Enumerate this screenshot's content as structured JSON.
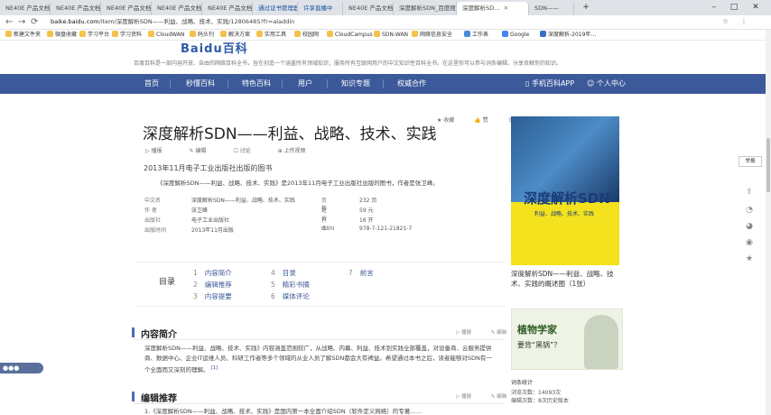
{
  "browser": {
    "tabs": [
      {
        "label": "NE40E 产品文档 V800R0…",
        "active": false
      },
      {
        "label": "NE40E 产品文档 V800R021…",
        "active": false
      },
      {
        "label": "NE40E 产品文档 V800R021…",
        "active": false
      },
      {
        "label": "NE40E 产品文档 V800R021…",
        "active": false
      },
      {
        "label": "NE40E 产品文档 V800R021…",
        "active": false
      },
      {
        "label": "通过证书管理器",
        "active": false
      },
      {
        "label": "许享直播中",
        "active": false
      },
      {
        "label": "NE40E 产品文档…",
        "active": false
      },
      {
        "label": "深度解析SDN_百度搜索",
        "active": false
      },
      {
        "label": "深度解析SD…",
        "active": true
      },
      {
        "label": "SDN——",
        "active": false
      }
    ],
    "url_host": "baike.baidu.com",
    "url_path": "/item/深度解析SDN——利益、战略、技术、实践/12806485?fr=aladdin",
    "bookmarks": [
      "新建文件夹",
      "微盘收藏",
      "学习平台",
      "学习资料",
      "CloudWAN",
      "码头刊",
      "解决方案",
      "实用工具",
      "校园网",
      "CloudCampus",
      "SDN-WAN",
      "网络信息安全",
      "工作表",
      "Google",
      "深度解析-2019年…"
    ]
  },
  "site": {
    "brand": "Baidu百科",
    "notice": "百度百科是一部内容开放、自由的网络百科全书，旨在创造一个涵盖所有领域知识，服务所有互联网用户的中文知识性百科全书。在这里你可以参与词条编辑，分享贡献你的知识。",
    "nav": [
      "首页",
      "秒懂百科",
      "特色百科",
      "用户",
      "知识专题",
      "权威合作"
    ],
    "nav_right": [
      "手机百科APP",
      "个人中心"
    ]
  },
  "article": {
    "title": "深度解析SDN——利益、战略、技术、实践",
    "actions": [
      "播报",
      "编辑",
      "讨论",
      "上传视频"
    ],
    "top_right": [
      "收藏",
      "赞"
    ],
    "subtitle": "2013年11月电子工业出版社出版的图书",
    "summary": "《深度解析SDN——利益、战略、技术、实践》是2013年11月电子工业出版社出版的图书，作者是张卫峰。",
    "info_rows": [
      {
        "k": "中文名",
        "v": "深度解析SDN——利益、战略、技术、实践",
        "k2": "页 数",
        "v2": "232 页"
      },
      {
        "k": "作 者",
        "v": "张卫峰",
        "k2": "定 价",
        "v2": "59 元"
      },
      {
        "k": "出版社",
        "v": "电子工业出版社",
        "k2": "开 本",
        "v2": "16 开"
      },
      {
        "k": "出版时间",
        "v": "2013年11月出版",
        "k2": "ISBN",
        "v2": "978-7-121-21821-7"
      }
    ],
    "toc_label": "目录",
    "toc": [
      {
        "n": "1",
        "t": "内容简介"
      },
      {
        "n": "2",
        "t": "编辑推荐"
      },
      {
        "n": "3",
        "t": "内容提要"
      },
      {
        "n": "4",
        "t": "目录"
      },
      {
        "n": "5",
        "t": "精彩书摘"
      },
      {
        "n": "6",
        "t": "媒体评论"
      },
      {
        "n": "7",
        "t": "前言"
      }
    ],
    "section1": "内容简介",
    "section1_ops": [
      "播报",
      "编辑"
    ],
    "section1_text": "深度解析SDN——利益、战略、技术、实践》内容涵盖范围较广，从战略、内幕、利益、技术到实践全部覆盖，对设备商、云服务提供商、数据中心、企业IT运维人员、科研工作者等多个领域的从业人员了解SDN都会大有裨益。希望通过本书之后，读者能够对SDN有一个全面而又深刻的理解。",
    "section1_ref": "[1]",
    "section2": "编辑推荐",
    "section2_ops": [
      "播报",
      "编辑"
    ],
    "section2_text": "1.《深度解析SDN——利益、战略、技术、实践》是国内第一本全面介绍SDN（软件定义网络）的专著……"
  },
  "sidebar": {
    "cover_title": "深度解析SDN",
    "cover_sub": "利益、战略、技术、实践",
    "caption": "深度解析SDN——利益、战略、技术、实践的概述图（1张）",
    "ad_title": "植物学家",
    "ad_sub": "要背“黑锅”？",
    "stats_head": "词条统计",
    "stats": [
      "浏览次数：14093次",
      "编辑次数：8次历史版本"
    ],
    "feedback": "举报"
  },
  "chat_label": "●●●"
}
